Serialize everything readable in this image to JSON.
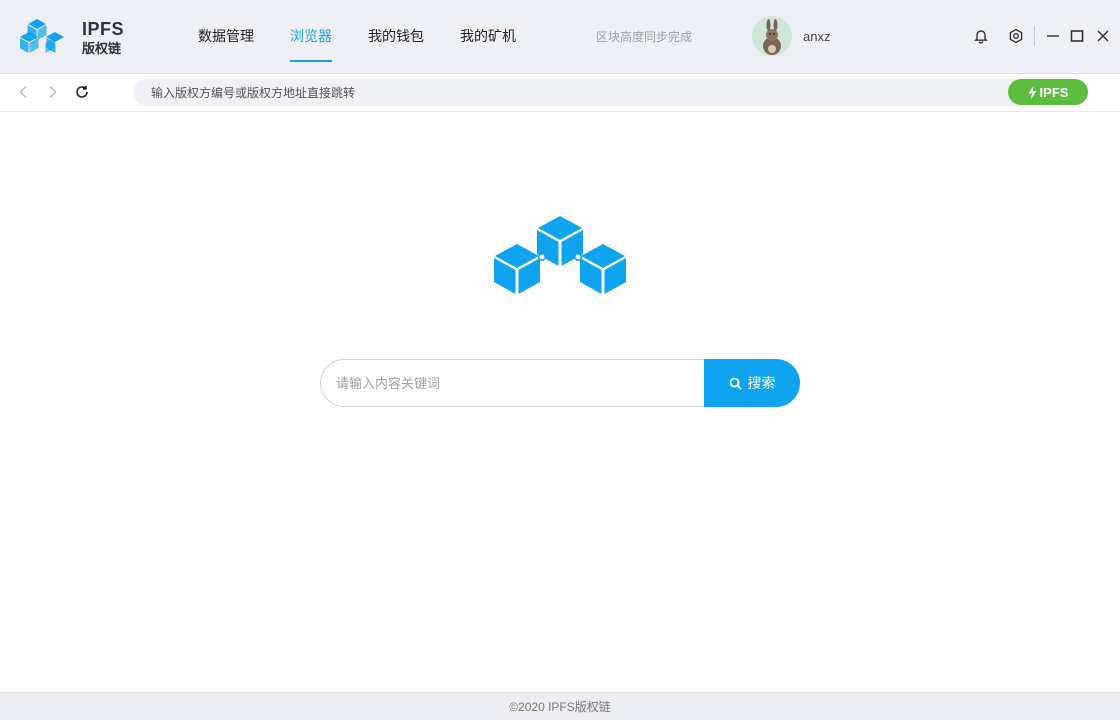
{
  "app": {
    "logo_title": "IPFS",
    "logo_subtitle": "版权链"
  },
  "nav": {
    "items": [
      {
        "label": "数据管理",
        "active": false
      },
      {
        "label": "浏览器",
        "active": true
      },
      {
        "label": "我的钱包",
        "active": false
      },
      {
        "label": "我的矿机",
        "active": false
      }
    ]
  },
  "status": {
    "sync_text": "区块高度同步完成"
  },
  "user": {
    "name": "anxz"
  },
  "toolbar_icons": [
    "bell-icon",
    "settings-icon",
    "minimize-icon",
    "maximize-icon",
    "close-icon"
  ],
  "addressbar": {
    "placeholder": "输入版权方编号或版权方地址直接跳转",
    "ipfs_label": "IPFS"
  },
  "search": {
    "placeholder": "请输入内容关键词",
    "button_label": "搜索"
  },
  "footer": {
    "text": "©2020 IPFS版权链"
  },
  "colors": {
    "accent": "#10a4f0",
    "ipfs_green": "#5cbd3e",
    "titlebar_bg": "#eef0f5"
  }
}
